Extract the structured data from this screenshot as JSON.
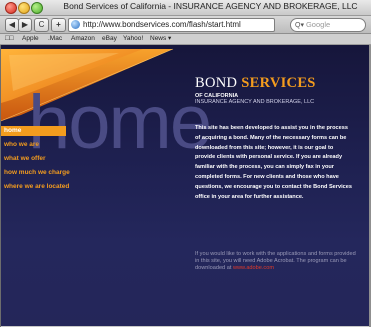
{
  "window": {
    "title": "Bond Services of California - INSURANCE AGENCY AND BROKERAGE, LLC"
  },
  "toolbar": {
    "back_label": "◀",
    "forward_label": "▶",
    "reload_label": "C",
    "add_label": "+",
    "url": "http://www.bondservices.com/flash/start.html",
    "search_placeholder": "Google"
  },
  "bookmarks": {
    "items": [
      "Apple",
      ".Mac",
      "Amazon",
      "eBay",
      "Yahoo!",
      "News ▾"
    ]
  },
  "site": {
    "hero_word": "home",
    "logo": {
      "word1": "BOND",
      "word2": "SERVICES",
      "line1": "OF CALIFORNIA",
      "line2": "INSURANCE AGENCY AND BROKERAGE, LLC"
    },
    "nav": [
      "home",
      "who we are",
      "what we offer",
      "how much we charge",
      "where we are located"
    ],
    "intro": "This site has been developed to assist you in the process of acquiring a bond. Many of the necessary forms can be downloaded from this site; however, it is our goal to provide clients with personal service. If you are already familiar with the process, you can simply fax in your completed forms. For new clients and those who have questions, we encourage you to contact the Bond Services office in your area for further assistance.",
    "acrobat_text": "If you would like to work with the applications and forms provided in this site, you will need Adobe Acrobat. The program can be downloaded at",
    "acrobat_link": "www.adobe.com",
    "colors": {
      "accent": "#f39c1e",
      "background": "#1e2050",
      "link": "#e03a2a"
    }
  }
}
